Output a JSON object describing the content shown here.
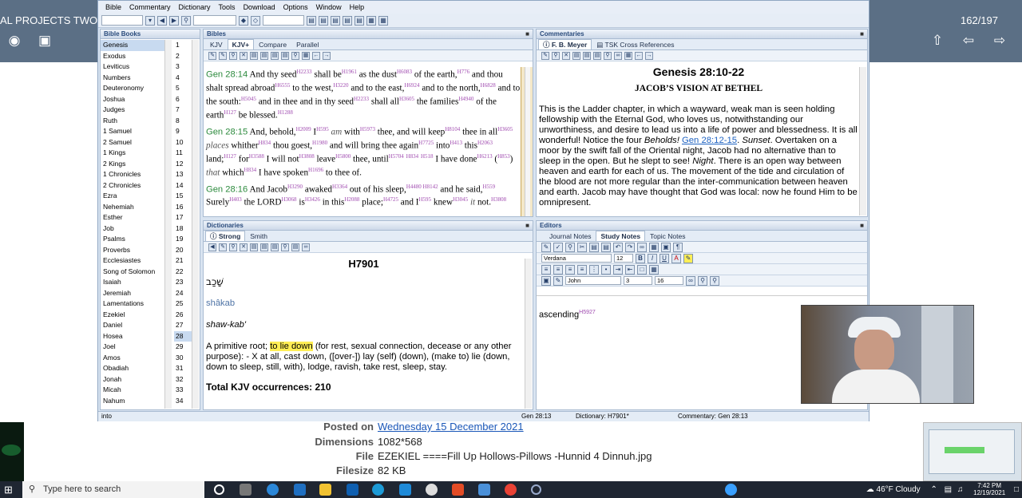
{
  "background": {
    "title_fragment": "AL PROJECTS TWO /",
    "counter": "162/197",
    "meta": [
      {
        "key": "Posted on",
        "value": "Wednesday 15 December 2021"
      },
      {
        "key": "Dimensions",
        "value": "1082*568"
      },
      {
        "key": "File",
        "value": "EZEKIEL ====Fill Up Hollows-Pillows -Hunnid 4 Dinnuh.jpg"
      },
      {
        "key": "Filesize",
        "value": "82 KB"
      }
    ]
  },
  "app": {
    "menu": [
      "Bible",
      "Commentary",
      "Dictionary",
      "Tools",
      "Download",
      "Options",
      "Window",
      "Help"
    ],
    "panes": {
      "books_title": "Bible Books",
      "bibles_title": "Bibles",
      "comment_title": "Commentaries",
      "dict_title": "Dictionaries",
      "editors_title": "Editors"
    },
    "books": [
      "Genesis",
      "Exodus",
      "Leviticus",
      "Numbers",
      "Deuteronomy",
      "Joshua",
      "Judges",
      "Ruth",
      "1 Samuel",
      "2 Samuel",
      "1 Kings",
      "2 Kings",
      "1 Chronicles",
      "2 Chronicles",
      "Ezra",
      "Nehemiah",
      "Esther",
      "Job",
      "Psalms",
      "Proverbs",
      "Ecclesiastes",
      "Song of Solomon",
      "Isaiah",
      "Jeremiah",
      "Lamentations",
      "Ezekiel",
      "Daniel",
      "Hosea",
      "Joel",
      "Amos",
      "Obadiah",
      "Jonah",
      "Micah",
      "Nahum"
    ],
    "chapters": [
      "1",
      "2",
      "3",
      "4",
      "5",
      "6",
      "7",
      "8",
      "9",
      "10",
      "11",
      "12",
      "13",
      "14",
      "15",
      "16",
      "17",
      "18",
      "19",
      "20",
      "21",
      "22",
      "23",
      "24",
      "25",
      "26",
      "27",
      "28",
      "29",
      "30",
      "31",
      "32",
      "33",
      "34"
    ],
    "selected_book": "Genesis",
    "selected_chapter": "28",
    "bible_tabs": [
      "KJV",
      "KJV+",
      "Compare",
      "Parallel"
    ],
    "verses": [
      {
        "ref": "Gen 28:14",
        "html_parts": [
          [
            "t",
            "And thy seed"
          ],
          [
            "s",
            "H2233"
          ],
          [
            "t",
            " shall be"
          ],
          [
            "s",
            "H1961"
          ],
          [
            "t",
            " as the dust"
          ],
          [
            "s",
            "H6083"
          ],
          [
            "t",
            " of the earth,"
          ],
          [
            "s",
            "H776"
          ],
          [
            "t",
            " and thou shalt spread abroad"
          ],
          [
            "s",
            "H6555"
          ],
          [
            "t",
            " to the west,"
          ],
          [
            "s",
            "H3220"
          ],
          [
            "t",
            " and to the east,"
          ],
          [
            "s",
            "H6924"
          ],
          [
            "t",
            " and to the north,"
          ],
          [
            "s",
            "H6828"
          ],
          [
            "t",
            " and to the south:"
          ],
          [
            "s",
            "H5045"
          ],
          [
            "t",
            " and in thee and in thy seed"
          ],
          [
            "s",
            "H2233"
          ],
          [
            "t",
            " shall all"
          ],
          [
            "s",
            "H3605"
          ],
          [
            "t",
            " the families"
          ],
          [
            "s",
            "H4940"
          ],
          [
            "t",
            " of the earth"
          ],
          [
            "s",
            "H127"
          ],
          [
            "t",
            " be blessed."
          ],
          [
            "s",
            "H1288"
          ]
        ]
      },
      {
        "ref": "Gen 28:15",
        "html_parts": [
          [
            "t",
            "And, behold,"
          ],
          [
            "s",
            "H2009"
          ],
          [
            "t",
            " I"
          ],
          [
            "s",
            "H595"
          ],
          [
            "t",
            " "
          ],
          [
            "i",
            "am"
          ],
          [
            "t",
            " with"
          ],
          [
            "s",
            "H5973"
          ],
          [
            "t",
            " thee, and will keep"
          ],
          [
            "s",
            "H8104"
          ],
          [
            "t",
            " thee in all"
          ],
          [
            "s",
            "H3605"
          ],
          [
            "t",
            " "
          ],
          [
            "i",
            "places"
          ],
          [
            "t",
            " whither"
          ],
          [
            "s",
            "H834"
          ],
          [
            "t",
            " thou goest,"
          ],
          [
            "s",
            "H1980"
          ],
          [
            "t",
            " and will bring thee again"
          ],
          [
            "s",
            "H7725"
          ],
          [
            "t",
            " into"
          ],
          [
            "s",
            "H413"
          ],
          [
            "t",
            " this"
          ],
          [
            "s",
            "H2063"
          ],
          [
            "t",
            " land;"
          ],
          [
            "s",
            "H127"
          ],
          [
            "t",
            " for"
          ],
          [
            "s",
            "H3588"
          ],
          [
            "t",
            " I will not"
          ],
          [
            "s",
            "H3808"
          ],
          [
            "t",
            " leave"
          ],
          [
            "s",
            "H5800"
          ],
          [
            "t",
            " thee, until"
          ],
          [
            "s",
            "H5704"
          ],
          [
            "t",
            " "
          ],
          [
            "s",
            "H834"
          ],
          [
            "t",
            " "
          ],
          [
            "s",
            "H518"
          ],
          [
            "t",
            " I have done"
          ],
          [
            "s",
            "H6213"
          ],
          [
            "t",
            " ("
          ],
          [
            "s",
            "H853"
          ],
          [
            "t",
            ") "
          ],
          [
            "i",
            "that"
          ],
          [
            "t",
            " which"
          ],
          [
            "s",
            "H834"
          ],
          [
            "t",
            " I have spoken"
          ],
          [
            "s",
            "H1696"
          ],
          [
            "t",
            " to thee of."
          ]
        ]
      },
      {
        "ref": "Gen 28:16",
        "html_parts": [
          [
            "t",
            "And Jacob"
          ],
          [
            "s",
            "H3290"
          ],
          [
            "t",
            " awaked"
          ],
          [
            "s",
            "H3364"
          ],
          [
            "t",
            " out of his sleep,"
          ],
          [
            "s",
            "H4480 H8142"
          ],
          [
            "t",
            " and he said,"
          ],
          [
            "s",
            "H559"
          ],
          [
            "t",
            " Surely"
          ],
          [
            "s",
            "H403"
          ],
          [
            "t",
            " the LORD"
          ],
          [
            "s",
            "H3068"
          ],
          [
            "t",
            " is"
          ],
          [
            "s",
            "H3426"
          ],
          [
            "t",
            " in this"
          ],
          [
            "s",
            "H2088"
          ],
          [
            "t",
            " place;"
          ],
          [
            "s",
            "H4725"
          ],
          [
            "t",
            " and I"
          ],
          [
            "s",
            "H595"
          ],
          [
            "t",
            " knew"
          ],
          [
            "s",
            "H3045"
          ],
          [
            "t",
            " "
          ],
          [
            "i",
            "it"
          ],
          [
            "t",
            " not."
          ],
          [
            "s",
            "H3808"
          ]
        ]
      }
    ],
    "comment_tabs": [
      "F. B. Meyer",
      "TSK Cross References"
    ],
    "comment": {
      "title": "Genesis 28:10-22",
      "subtitle": "JACOB’S VISION AT BETHEL",
      "p1": "This is the Ladder chapter, in which a wayward, weak man is seen holding fellowship with the Eternal God, who loves us, notwithstanding our unworthiness, and desire to lead us into a life of power and blessedness. It is all wonderful! Notice the four",
      "p1_ital": "Beholds!",
      "p1_link": "Gen 28:12-15",
      "p1_end": ".",
      "p2_ital1": "Sunset",
      "p2a": ". Overtaken on a moor by the swift fall of the Oriental night, Jacob had no alternative than to sleep in the open. But he slept to see!",
      "p2_ital2": "Night",
      "p2b": ". There is an open way between heaven and earth for each of us. The movement of the tide and circulation of the blood are not more regular than the inter-communication between heaven and earth. Jacob may have thought that God was local: now he found Him to be omnipresent."
    },
    "dict_tabs": [
      "Strong",
      "Smith"
    ],
    "dict": {
      "word": "H7901",
      "hebrew": "שָׁכַב",
      "translit": "shâkab",
      "pron": "shaw-kab'",
      "def_pre": "A primitive root;",
      "def_hl": "to lie down",
      "def_post": "(for rest, sexual connection, decease or any other purpose): -    X at all, cast down, ([over-]) lay (self) (down), (make to) lie (down, down to sleep, still, with), lodge, ravish, take rest, sleep, stay.",
      "total": "Total KJV occurrences: 210"
    },
    "editor_tabs": [
      "Journal Notes",
      "Study Notes",
      "Topic Notes"
    ],
    "editor": {
      "font": "Verdana",
      "size": "12",
      "author": "John",
      "num1": "3",
      "num2": "16",
      "text": "ascending",
      "text_strong": "H5927"
    },
    "status": {
      "left": "into",
      "ref": "Gen 28:13",
      "dict": "Dictionary: H7901*",
      "comment": "Commentary: Gen 28:13"
    }
  },
  "taskbar": {
    "search_placeholder": "Type here to search",
    "weather": "46°F  Cloudy",
    "time": "7:42 PM",
    "date": "12/19/2021"
  }
}
